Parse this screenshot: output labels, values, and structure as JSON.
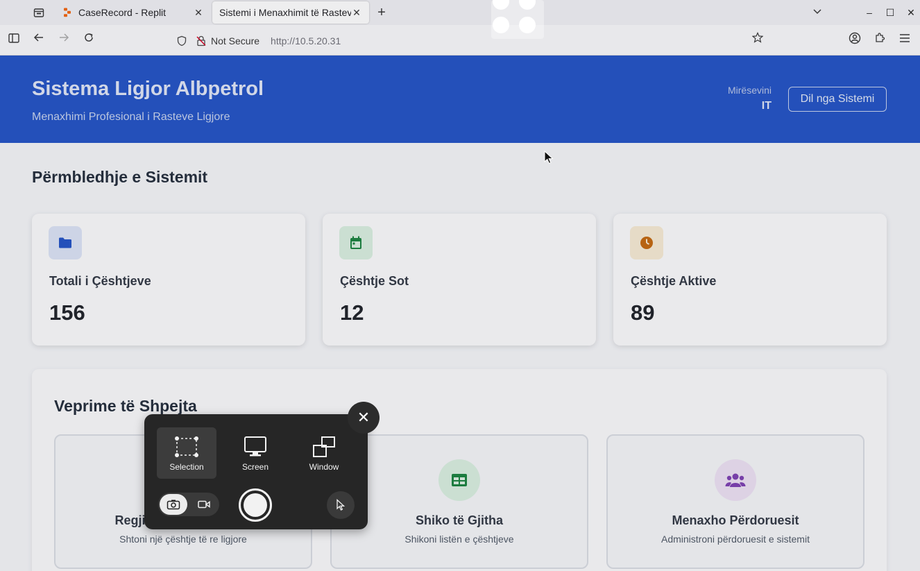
{
  "browser": {
    "tabs": [
      {
        "title": "CaseRecord - Replit",
        "close": "✕"
      },
      {
        "title": "Sistemi i Menaxhimit të Rasteve",
        "close": "✕"
      }
    ],
    "new_tab": "+",
    "window_controls": {
      "minimize": "–",
      "maximize": "☐",
      "close": "✕"
    },
    "security_label": "Not Secure",
    "url": "http://10.5.20.31"
  },
  "header": {
    "title": "Sistema Ligjor Albpetrol",
    "subtitle": "Menaxhimi Profesional i Rasteve Ligjore",
    "welcome_label": "Mirësevini",
    "username": "IT",
    "logout_label": "Dil nga Sistemi"
  },
  "overview": {
    "title": "Përmbledhje e Sistemit",
    "stats": [
      {
        "label": "Totali i Çështjeve",
        "value": "156",
        "icon": "folder-icon",
        "color": "#1f50c4",
        "bg": "#dbe3f5"
      },
      {
        "label": "Çështje Sot",
        "value": "12",
        "icon": "calendar-icon",
        "color": "#16803c",
        "bg": "#d8efdf"
      },
      {
        "label": "Çështje Aktive",
        "value": "89",
        "icon": "clock-icon",
        "color": "#c2650a",
        "bg": "#f6ead3"
      }
    ]
  },
  "quick_actions": {
    "title": "Veprime të Shpejta",
    "items": [
      {
        "label": "Regjistro Çështje të Re",
        "desc": "Shtoni një çështje të re ligjore",
        "icon": "plus-icon",
        "color": "#1f50c4",
        "bg": "#dbe3f5"
      },
      {
        "label": "Shiko të Gjitha",
        "desc": "Shikoni listën e çështjeve",
        "icon": "table-icon",
        "color": "#16803c",
        "bg": "#d8efdf"
      },
      {
        "label": "Menaxho Përdoruesit",
        "desc": "Administroni përdoruesit e sistemit",
        "icon": "users-icon",
        "color": "#7b3bb0",
        "bg": "#ece0f3"
      }
    ]
  },
  "screenshot_tool": {
    "modes": [
      {
        "label": "Selection",
        "icon": "selection-icon",
        "active": true
      },
      {
        "label": "Screen",
        "icon": "monitor-icon",
        "active": false
      },
      {
        "label": "Window",
        "icon": "window-icon",
        "active": false
      }
    ],
    "close": "✕"
  }
}
